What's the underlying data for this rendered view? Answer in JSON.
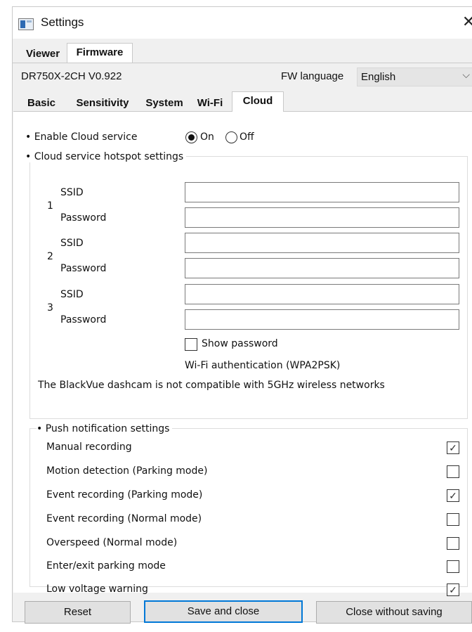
{
  "window": {
    "title": "Settings",
    "close_glyph": "✕",
    "app_icon": "settings-window-icon"
  },
  "top_tabs": [
    {
      "label": "Viewer",
      "active": false
    },
    {
      "label": "Firmware",
      "active": true
    }
  ],
  "firmware": {
    "model_version": "DR750X-2CH  V0.922",
    "fw_language_label": "FW language",
    "fw_language_value": "English"
  },
  "sub_tabs": [
    {
      "label": "Basic",
      "active": false
    },
    {
      "label": "Sensitivity",
      "active": false
    },
    {
      "label": "System",
      "active": false
    },
    {
      "label": "Wi-Fi",
      "active": false
    },
    {
      "label": "Cloud",
      "active": true
    }
  ],
  "cloud": {
    "enable_label": "• Enable Cloud service",
    "on_label": "On",
    "off_label": "Off",
    "enabled": true,
    "hotspot_title": "• Cloud service hotspot settings",
    "hotspots": [
      {
        "number": "1",
        "ssid_label": "SSID",
        "password_label": "Password",
        "ssid_value": "",
        "password_value": ""
      },
      {
        "number": "2",
        "ssid_label": "SSID",
        "password_label": "Password",
        "ssid_value": "",
        "password_value": ""
      },
      {
        "number": "3",
        "ssid_label": "SSID",
        "password_label": "Password",
        "ssid_value": "",
        "password_value": ""
      }
    ],
    "show_password_label": "Show password",
    "show_password_checked": false,
    "auth_note": "Wi-Fi authentication (WPA2PSK)",
    "compat_note": "The BlackVue dashcam is not compatible with 5GHz wireless networks"
  },
  "push": {
    "title": "• Push notification settings",
    "items": [
      {
        "label": "Manual recording",
        "checked": true
      },
      {
        "label": "Motion detection (Parking mode)",
        "checked": false
      },
      {
        "label": "Event recording (Parking mode)",
        "checked": true
      },
      {
        "label": "Event recording (Normal mode)",
        "checked": false
      },
      {
        "label": "Overspeed (Normal mode)",
        "checked": false
      },
      {
        "label": "Enter/exit parking mode",
        "checked": false
      },
      {
        "label": "Low voltage warning",
        "checked": true
      }
    ]
  },
  "buttons": {
    "reset": "Reset",
    "save_close": "Save and close",
    "close_no_save": "Close without saving"
  }
}
